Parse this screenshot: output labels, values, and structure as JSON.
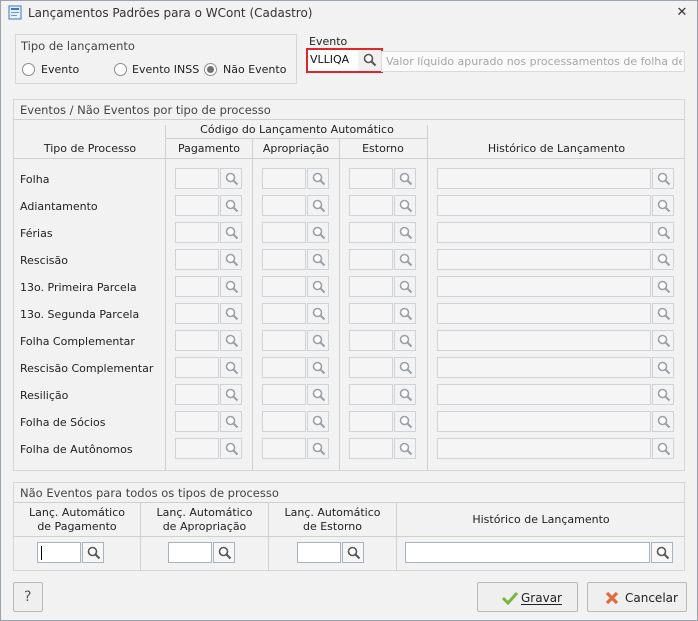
{
  "window": {
    "title": "Lançamentos Padrões para o WCont (Cadastro)",
    "close_label": "✕"
  },
  "tipo_lancamento": {
    "title": "Tipo de lançamento",
    "options": [
      "Evento",
      "Evento INSS",
      "Não Evento"
    ],
    "selected": "Não Evento"
  },
  "evento": {
    "label": "Evento",
    "value": "VLLIQA",
    "description": "Valor líquido apurado nos processamentos de folha de au"
  },
  "eventos_group": {
    "title": "Eventos / Não Eventos por tipo de processo",
    "header_top": "Código do Lançamento Automático",
    "col_tipo": "Tipo de Processo",
    "col_pagamento": "Pagamento",
    "col_apropriacao": "Apropriação",
    "col_estorno": "Estorno",
    "col_historico": "Histórico de Lançamento",
    "rows": [
      "Folha",
      "Adiantamento",
      "Férias",
      "Rescisão",
      "13o. Primeira Parcela",
      "13o. Segunda Parcela",
      "Folha Complementar",
      "Rescisão Complementar",
      "Resilição",
      "Folha de Sócios",
      "Folha de Autônomos"
    ]
  },
  "nao_eventos_group": {
    "title": "Não Eventos para todos os tipos de processo",
    "col_pag_1": "Lanç. Automático",
    "col_pag_2": "de Pagamento",
    "col_apr_1": "Lanç. Automático",
    "col_apr_2": "de Apropriação",
    "col_est_1": "Lanç. Automático",
    "col_est_2": "de Estorno",
    "col_hist": "Histórico de Lançamento"
  },
  "footer": {
    "help_label": "?",
    "save_label": "Gravar",
    "cancel_label": "Cancelar"
  },
  "colors": {
    "highlight_border": "#e0262b",
    "save_icon": "#7cb342",
    "cancel_icon": "#e06a3b"
  }
}
